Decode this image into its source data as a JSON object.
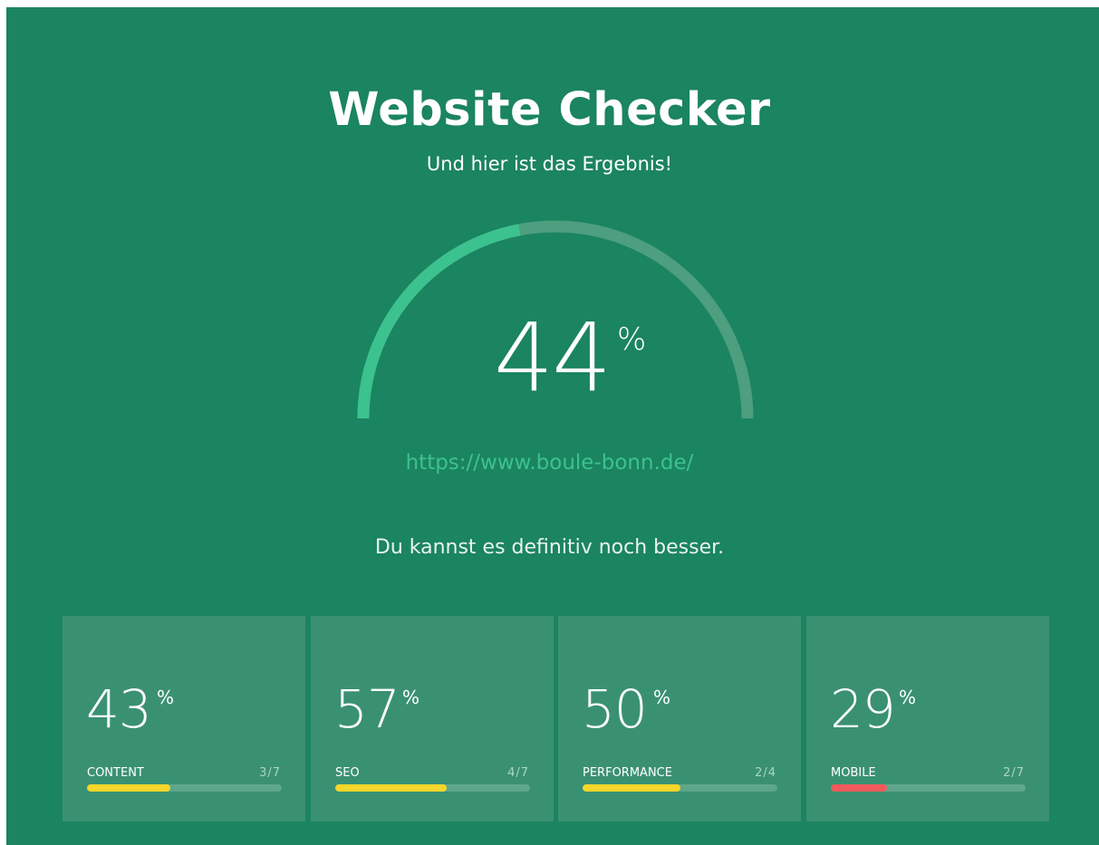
{
  "header": {
    "title": "Website Checker",
    "subtitle": "Und hier ist das Ergebnis!"
  },
  "result": {
    "score": 44,
    "score_text": "44",
    "unit": "%",
    "url": "https://www.boule-bonn.de/",
    "verdict": "Du kannst es definitiv noch besser."
  },
  "colors": {
    "background": "#1b8460",
    "card": "#3a9172",
    "gauge_fill": "#3cc28e",
    "gauge_track": "#4e9e80",
    "bar_track": "#5fa68b",
    "warn_yellow": "#f5d62b",
    "bad_red": "#f05a5a"
  },
  "cards": [
    {
      "score": "43",
      "unit": "%",
      "label": "CONTENT",
      "ratio": "3/7",
      "fraction": 0.43,
      "color": "#f5d62b"
    },
    {
      "score": "57",
      "unit": "%",
      "label": "SEO",
      "ratio": "4/7",
      "fraction": 0.57,
      "color": "#f5d62b"
    },
    {
      "score": "50",
      "unit": "%",
      "label": "PERFORMANCE",
      "ratio": "2/4",
      "fraction": 0.5,
      "color": "#f5d62b"
    },
    {
      "score": "29",
      "unit": "%",
      "label": "MOBILE",
      "ratio": "2/7",
      "fraction": 0.29,
      "color": "#f05a5a"
    }
  ]
}
